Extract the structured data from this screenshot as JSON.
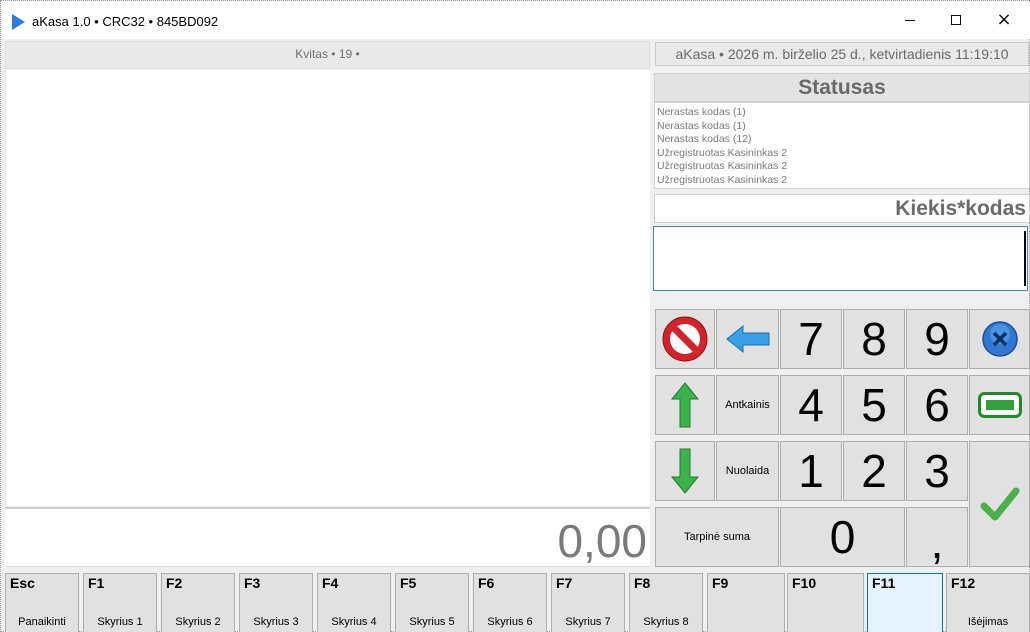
{
  "window": {
    "title": "aKasa 1.0 • CRC32 • 845BD092",
    "minimize_symbol": "",
    "close_symbol": "×"
  },
  "receipt": {
    "header": "Kvitas • 19 •",
    "total": "0,00"
  },
  "datetime": "aKasa • 2026 m. birželio 25 d., ketvirtadienis 11:19:10",
  "status": {
    "title": "Statusas",
    "log": [
      "Nerastas kodas (1)",
      "Nerastas kodas (1)",
      "Nerastas kodas (12)",
      "Užregistruotas Kasininkas 2",
      "Užregistruotas Kasininkas 2",
      "Užregistruotas Kasininkas 2"
    ]
  },
  "input": {
    "label": "Kiekis*kodas",
    "value": ""
  },
  "keypad": {
    "cancel_icon": "cancel-icon",
    "backspace_icon": "arrow-left-icon",
    "up_icon": "arrow-up-icon",
    "down_icon": "arrow-down-icon",
    "close_icon": "close-x-icon",
    "card_icon": "card-icon",
    "confirm_icon": "checkmark-icon",
    "digits": {
      "7": "7",
      "8": "8",
      "9": "9",
      "4": "4",
      "5": "5",
      "6": "6",
      "1": "1",
      "2": "2",
      "3": "3",
      "0": "0"
    },
    "comma": ",",
    "antkainis": "Antkainis",
    "nuolaida": "Nuolaida",
    "tarpine_suma": "Tarpinė suma"
  },
  "function_keys": [
    {
      "code": "Esc",
      "label": "Panaikinti"
    },
    {
      "code": "F1",
      "label": "Skyrius 1"
    },
    {
      "code": "F2",
      "label": "Skyrius 2"
    },
    {
      "code": "F3",
      "label": "Skyrius 3"
    },
    {
      "code": "F4",
      "label": "Skyrius 4"
    },
    {
      "code": "F5",
      "label": "Skyrius 5"
    },
    {
      "code": "F6",
      "label": "Skyrius 6"
    },
    {
      "code": "F7",
      "label": "Skyrius 7"
    },
    {
      "code": "F8",
      "label": "Skyrius 8"
    },
    {
      "code": "F9",
      "label": ""
    },
    {
      "code": "F10",
      "label": ""
    },
    {
      "code": "F11",
      "label": ""
    },
    {
      "code": "F12",
      "label": "Išėjimas"
    }
  ],
  "colors": {
    "accent_blue": "#0078d7",
    "cancel_red": "#d2232a",
    "arrow_green": "#3cb34a",
    "arrow_blue": "#3aa0e6",
    "checkmark_green": "#4ab04a"
  }
}
